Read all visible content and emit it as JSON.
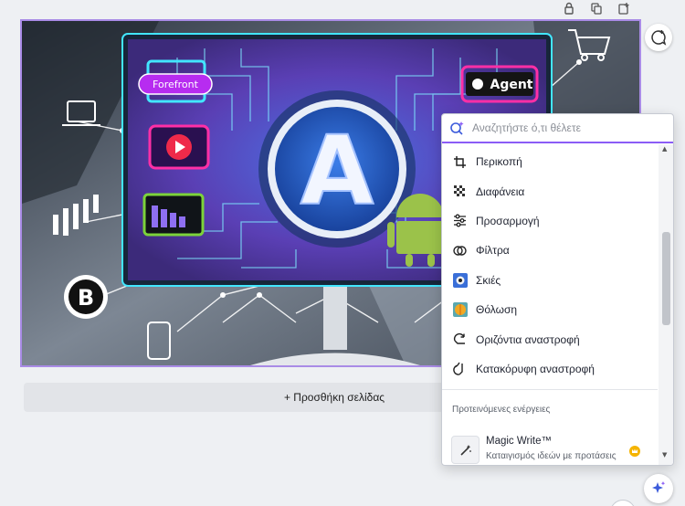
{
  "canvas": {
    "badges": {
      "forefront": "Forefront",
      "agent": "Agent",
      "big_letter": "A",
      "b_logo": "B"
    }
  },
  "add_page_label": "+ Προσθήκη σελίδας",
  "context_menu": {
    "search_placeholder": "Αναζητήστε ό,τι θέλετε",
    "items": [
      {
        "label": "Περικοπή",
        "icon": "crop-icon"
      },
      {
        "label": "Διαφάνεια",
        "icon": "transparency-icon"
      },
      {
        "label": "Προσαρμογή",
        "icon": "adjust-icon"
      },
      {
        "label": "Φίλτρα",
        "icon": "filters-icon"
      },
      {
        "label": "Σκιές",
        "icon": "shadows-icon"
      },
      {
        "label": "Θόλωση",
        "icon": "blur-icon"
      },
      {
        "label": "Οριζόντια αναστροφή",
        "icon": "flip-horizontal-icon"
      },
      {
        "label": "Κατακόρυφη αναστροφή",
        "icon": "flip-vertical-icon"
      }
    ],
    "suggested_title": "Προτεινόμενες ενέργειες",
    "suggested_actions": [
      {
        "title": "Magic Write™",
        "subtitle": "Καταιγισμός ιδεών με προτάσεις",
        "icon": "magic-write-icon",
        "badge": "crown-icon"
      }
    ]
  },
  "colors": {
    "accent": "#8b5cf6",
    "selection_border": "#a98be6",
    "crown": "#f5b400",
    "scene_blue": "#3a66d6",
    "scene_purple": "#6a3fb0",
    "cyan": "#42e6ff",
    "magenta": "#ff2fa6",
    "green": "#7cd33a",
    "android": "#9bc24a"
  }
}
